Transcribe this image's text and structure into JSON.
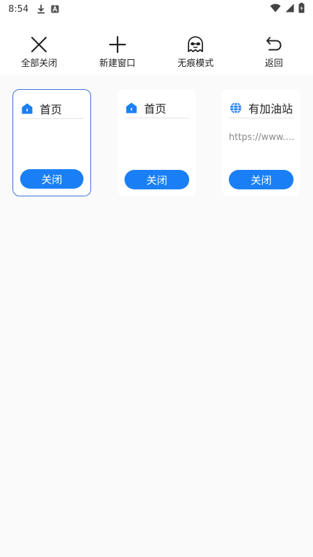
{
  "status_bar": {
    "time": "8:54",
    "icons": [
      "download-icon",
      "keyboard-a-icon",
      "wifi-icon",
      "signal-icon",
      "battery-icon"
    ]
  },
  "toolbar": {
    "close_all_label": "全部关闭",
    "new_window_label": "新建窗口",
    "incognito_label": "无痕模式",
    "back_label": "返回"
  },
  "tabs": [
    {
      "title": "首页",
      "url": "",
      "icon": "home-icon",
      "close_label": "关闭",
      "active": true
    },
    {
      "title": "首页",
      "url": "",
      "icon": "home-icon",
      "close_label": "关闭",
      "active": false
    },
    {
      "title": "有加油站",
      "url": "https://www.baidu.com",
      "icon": "globe-icon",
      "close_label": "关闭",
      "active": false
    }
  ],
  "colors": {
    "accent": "#1a7ff5",
    "active_border": "#3b6fd6",
    "background": "#fafafa"
  }
}
